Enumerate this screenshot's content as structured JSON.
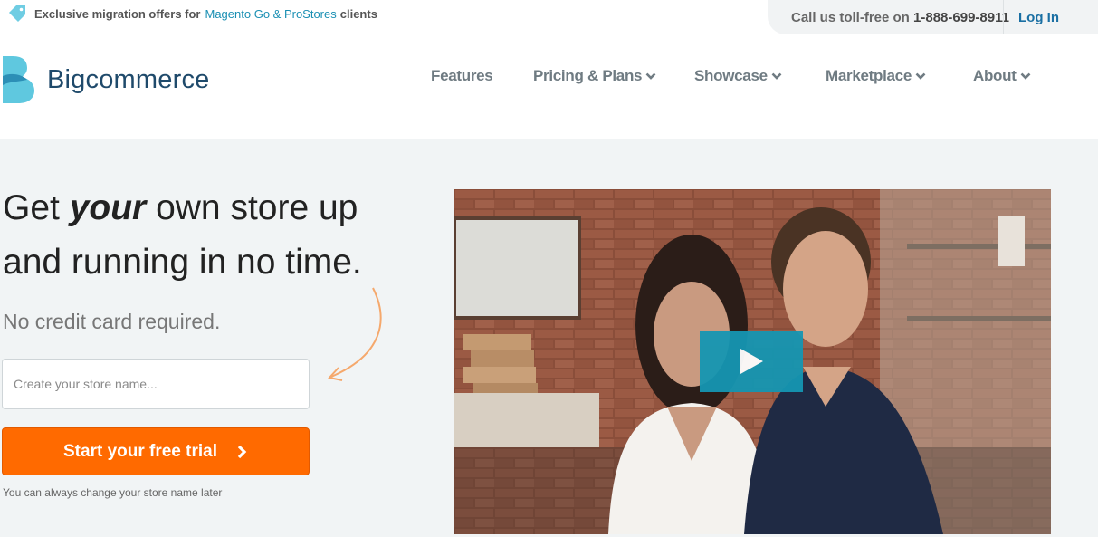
{
  "promo": {
    "prefix": "Exclusive migration offers for",
    "link": "Magento Go & ProStores",
    "suffix": "clients",
    "icon": "tag-icon"
  },
  "utility": {
    "call_label": "Call us toll-free on",
    "phone": "1-888-699-8911",
    "login": "Log In"
  },
  "brand": {
    "name": "Bigcommerce",
    "colors": {
      "logo_light": "#5fc8df",
      "logo_dark": "#1f4a6b"
    }
  },
  "nav": [
    {
      "label": "Features",
      "dropdown": false
    },
    {
      "label": "Pricing & Plans",
      "dropdown": true
    },
    {
      "label": "Showcase",
      "dropdown": true
    },
    {
      "label": "Marketplace",
      "dropdown": true
    },
    {
      "label": "About",
      "dropdown": true
    }
  ],
  "hero": {
    "headline_prefix": "Get",
    "headline_emphasis": "your",
    "headline_line1_rest": "own store up",
    "headline_line2": "and running in no time.",
    "subline": "No credit card required.",
    "input_placeholder": "Create your store name...",
    "cta_label": "Start your free trial",
    "note": "You can always change your store name later"
  },
  "video": {
    "play_icon": "play-icon"
  },
  "colors": {
    "accent_orange": "#ff6a00",
    "link_blue": "#1a8fb3",
    "play_blue": "#1596b2",
    "hero_bg": "#f1f4f5"
  }
}
